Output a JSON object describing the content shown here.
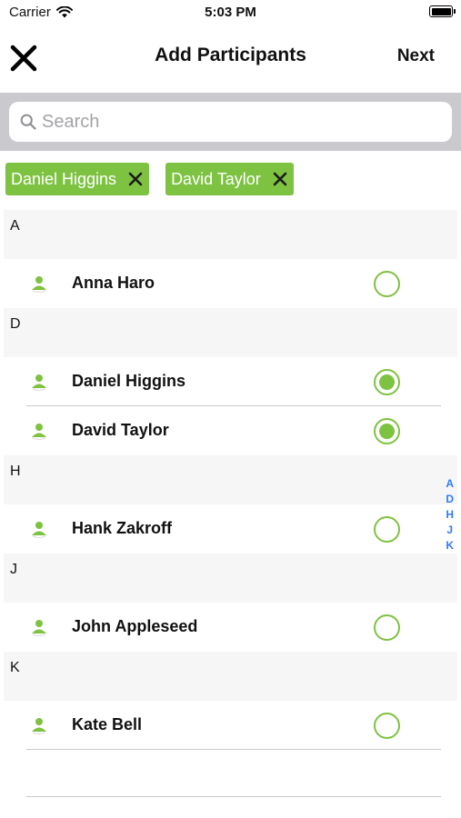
{
  "status_bar": {
    "carrier": "Carrier",
    "time": "5:03 PM",
    "wifi_icon": "wifi-icon",
    "battery_icon": "battery-icon"
  },
  "nav": {
    "title": "Add Participants",
    "next_label": "Next",
    "close_icon": "close-icon"
  },
  "search": {
    "placeholder": "Search",
    "value": "",
    "icon": "search-icon"
  },
  "chips": [
    {
      "label": "Daniel Higgins",
      "remove_icon": "close-icon"
    },
    {
      "label": "David Taylor",
      "remove_icon": "close-icon"
    }
  ],
  "sections": [
    {
      "header": "A",
      "contacts": [
        {
          "name": "Anna Haro",
          "selected": false
        }
      ]
    },
    {
      "header": "D",
      "contacts": [
        {
          "name": "Daniel Higgins",
          "selected": true
        },
        {
          "name": "David Taylor",
          "selected": true
        }
      ]
    },
    {
      "header": "H",
      "contacts": [
        {
          "name": "Hank Zakroff",
          "selected": false
        }
      ]
    },
    {
      "header": "J",
      "contacts": [
        {
          "name": "John Appleseed",
          "selected": false
        }
      ]
    },
    {
      "header": "K",
      "contacts": [
        {
          "name": "Kate Bell",
          "selected": false
        }
      ]
    }
  ],
  "index_letters": [
    "A",
    "D",
    "H",
    "J",
    "K"
  ],
  "colors": {
    "accent_green": "#7ec242",
    "index_blue": "#2f7cf6",
    "search_band": "#c9c9ce",
    "section_header_bg": "#f6f6f6"
  }
}
